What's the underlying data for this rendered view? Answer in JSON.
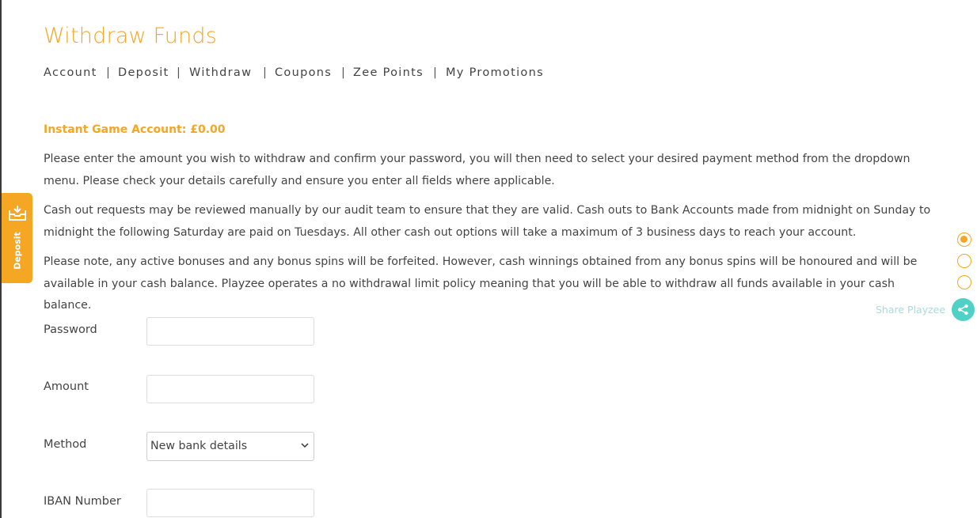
{
  "page": {
    "title": "Withdraw Funds"
  },
  "subnav": {
    "items": [
      "Account",
      "Deposit",
      "Withdraw",
      "Coupons",
      "Zee Points",
      "My Promotions"
    ],
    "separator": "|"
  },
  "balance": {
    "label": "Instant Game Account:",
    "value": "£0.00"
  },
  "paragraphs": [
    "Please enter the amount you wish to withdraw and confirm your password, you will then need to select your desired payment method from the dropdown menu. Please check your details carefully and ensure you enter all fields where applicable.",
    "Cash out requests may be reviewed manually by our audit team to ensure that they are valid. Cash outs to Bank Accounts made from midnight on Sunday to midnight the following Saturday are paid on Tuesdays. All other cash out options will take a maximum of 3 business days to reach your account.",
    "Please note, any active bonuses and any bonus spins will be forfeited. However, cash winnings obtained from any bonus spins will be honoured and will be available in your cash balance. Playzee operates a no withdrawal limit policy meaning that you will be able to withdraw all funds available in your cash balance."
  ],
  "form": {
    "password_label": "Password",
    "password_value": "",
    "amount_label": "Amount",
    "amount_value": "",
    "method_label": "Method",
    "method_selected": "New bank details",
    "iban_label": "IBAN Number",
    "iban_value": ""
  },
  "deposit_tab": {
    "label": "Deposit",
    "icon": "deposit-tray-icon"
  },
  "side_nav": {
    "active_index": 0,
    "count": 3
  },
  "share": {
    "label": "Share Playzee",
    "icon": "share-icon"
  },
  "colors": {
    "accent": "#f5a623",
    "share": "#4fd1c5",
    "share_text": "#a8dcd9",
    "text": "#444444"
  }
}
